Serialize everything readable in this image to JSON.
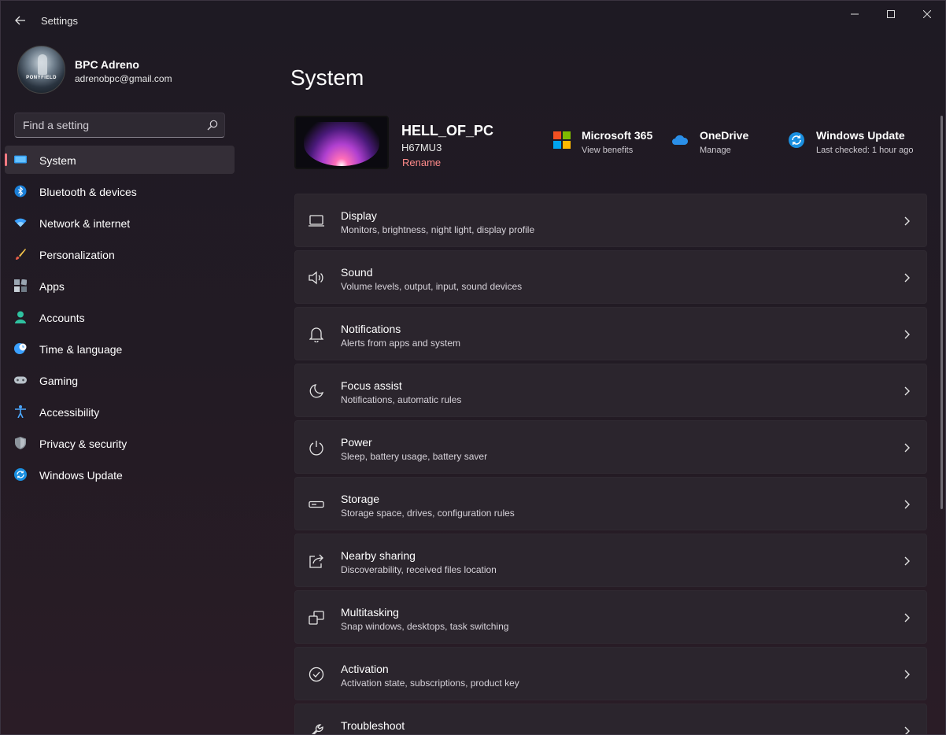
{
  "window": {
    "title": "Settings"
  },
  "profile": {
    "name": "BPC Adreno",
    "email": "adrenobpc@gmail.com",
    "avatar_text": "PONYFIELD"
  },
  "search": {
    "placeholder": "Find a setting"
  },
  "nav": {
    "items": [
      {
        "label": "System",
        "icon": "monitor-icon",
        "active": true
      },
      {
        "label": "Bluetooth & devices",
        "icon": "bluetooth-icon"
      },
      {
        "label": "Network & internet",
        "icon": "wifi-icon"
      },
      {
        "label": "Personalization",
        "icon": "brush-icon"
      },
      {
        "label": "Apps",
        "icon": "apps-icon"
      },
      {
        "label": "Accounts",
        "icon": "person-icon"
      },
      {
        "label": "Time & language",
        "icon": "globe-clock-icon"
      },
      {
        "label": "Gaming",
        "icon": "gamepad-icon"
      },
      {
        "label": "Accessibility",
        "icon": "accessibility-icon"
      },
      {
        "label": "Privacy & security",
        "icon": "shield-icon"
      },
      {
        "label": "Windows Update",
        "icon": "update-icon"
      }
    ]
  },
  "main": {
    "title": "System",
    "device": {
      "name": "HELL_OF_PC",
      "model": "H67MU3",
      "rename": "Rename"
    },
    "quick_links": [
      {
        "title": "Microsoft 365",
        "sub": "View benefits",
        "icon": "microsoft-logo-icon"
      },
      {
        "title": "OneDrive",
        "sub": "Manage",
        "icon": "cloud-icon"
      },
      {
        "title": "Windows Update",
        "sub": "Last checked: 1 hour ago",
        "icon": "update-icon"
      }
    ],
    "cards": [
      {
        "title": "Display",
        "sub": "Monitors, brightness, night light, display profile",
        "icon": "display-icon"
      },
      {
        "title": "Sound",
        "sub": "Volume levels, output, input, sound devices",
        "icon": "speaker-icon"
      },
      {
        "title": "Notifications",
        "sub": "Alerts from apps and system",
        "icon": "bell-icon"
      },
      {
        "title": "Focus assist",
        "sub": "Notifications, automatic rules",
        "icon": "moon-icon"
      },
      {
        "title": "Power",
        "sub": "Sleep, battery usage, battery saver",
        "icon": "power-icon"
      },
      {
        "title": "Storage",
        "sub": "Storage space, drives, configuration rules",
        "icon": "storage-icon"
      },
      {
        "title": "Nearby sharing",
        "sub": "Discoverability, received files location",
        "icon": "share-icon"
      },
      {
        "title": "Multitasking",
        "sub": "Snap windows, desktops, task switching",
        "icon": "multitask-icon"
      },
      {
        "title": "Activation",
        "sub": "Activation state, subscriptions, product key",
        "icon": "check-circle-icon"
      },
      {
        "title": "Troubleshoot",
        "sub": "",
        "icon": "wrench-icon"
      }
    ]
  },
  "colors": {
    "accent": "#ff7a82",
    "rename": "#ff8a8a",
    "card_bg": "#2b252d"
  }
}
